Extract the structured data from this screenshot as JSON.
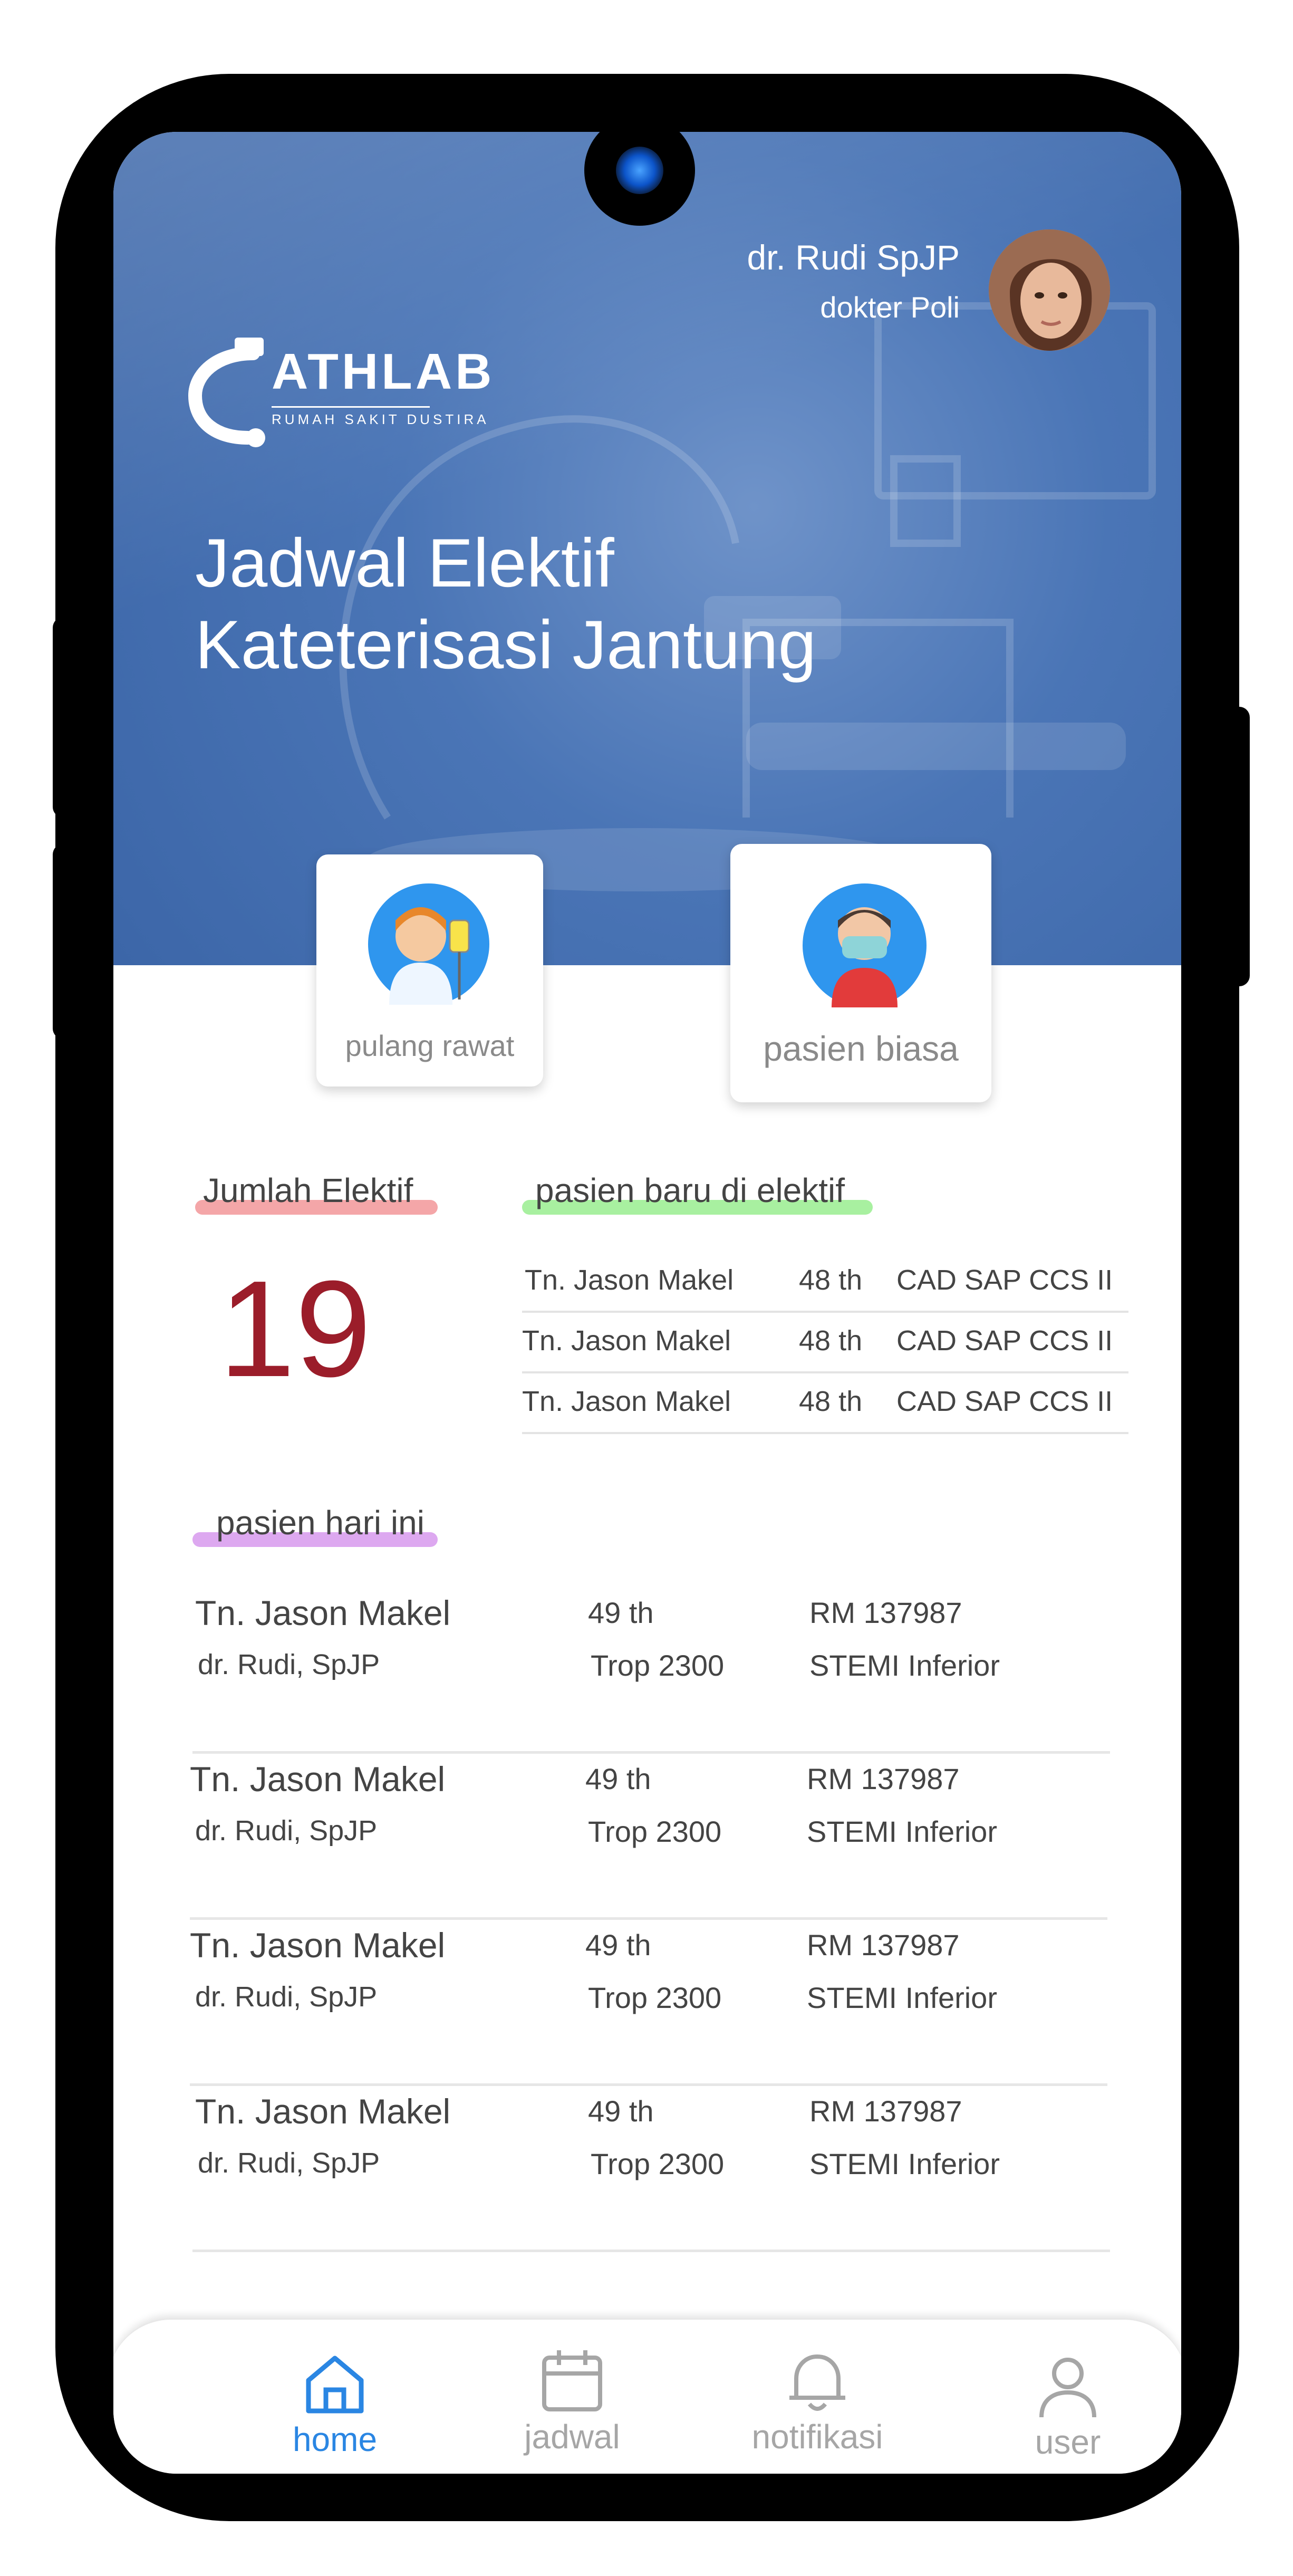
{
  "header": {
    "user_name": "dr. Rudi SpJP",
    "user_role": "dokter Poli",
    "logo_text": "ATHLAB",
    "logo_subtitle": "RUMAH SAKIT DUSTIRA",
    "title_line1": "Jadwal Elektif",
    "title_line2": "Kateterisasi Jantung"
  },
  "categories": [
    {
      "label": "pulang rawat",
      "icon": "nurse-icon"
    },
    {
      "label": "pasien biasa",
      "icon": "masked-patient-icon"
    }
  ],
  "summary": {
    "jumlah_label": "Jumlah Elektif",
    "jumlah_value": "19",
    "new_label": "pasien baru di elektif",
    "new_patients": [
      {
        "name": "Tn. Jason Makel",
        "age": "48 th",
        "diagnosis": "CAD SAP CCS II"
      },
      {
        "name": "Tn. Jason Makel",
        "age": "48 th",
        "diagnosis": "CAD SAP CCS II"
      },
      {
        "name": "Tn. Jason Makel",
        "age": "48 th",
        "diagnosis": "CAD SAP CCS II"
      }
    ]
  },
  "today": {
    "label": "pasien hari ini",
    "patients": [
      {
        "name": "Tn. Jason Makel",
        "doctor": "dr. Rudi, SpJP",
        "age": "49 th",
        "trop": "Trop 2300",
        "rm": "RM 137987",
        "diagnosis": "STEMI Inferior"
      },
      {
        "name": "Tn. Jason Makel",
        "doctor": "dr. Rudi, SpJP",
        "age": "49 th",
        "trop": "Trop 2300",
        "rm": "RM 137987",
        "diagnosis": "STEMI Inferior"
      },
      {
        "name": "Tn. Jason Makel",
        "doctor": "dr. Rudi, SpJP",
        "age": "49 th",
        "trop": "Trop 2300",
        "rm": "RM 137987",
        "diagnosis": "STEMI Inferior"
      },
      {
        "name": "Tn. Jason Makel",
        "doctor": "dr. Rudi, SpJP",
        "age": "49 th",
        "trop": "Trop 2300",
        "rm": "RM 137987",
        "diagnosis": "STEMI Inferior"
      }
    ]
  },
  "nav": [
    {
      "label": "home",
      "icon": "home-icon",
      "active": true
    },
    {
      "label": "jadwal",
      "icon": "calendar-icon",
      "active": false
    },
    {
      "label": "notifikasi",
      "icon": "bell-icon",
      "active": false
    },
    {
      "label": "user",
      "icon": "user-icon",
      "active": false
    }
  ],
  "colors": {
    "accent": "#2a86e3",
    "hero": "#4a75b6",
    "big_number": "#9b1d2a",
    "hl_jumlah": "#f4a6a8",
    "hl_new": "#a8f0a0",
    "hl_today": "#dda8f0"
  }
}
